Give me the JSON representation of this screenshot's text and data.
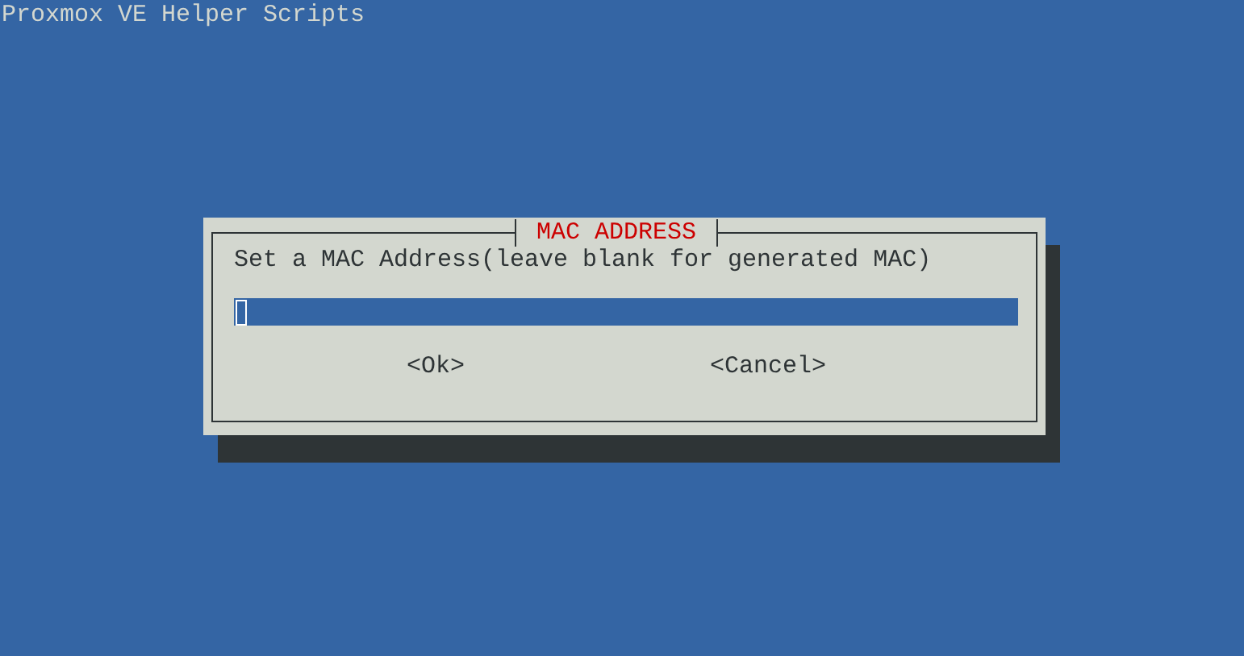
{
  "screen_title": "Proxmox VE Helper Scripts",
  "dialog": {
    "title": "MAC ADDRESS",
    "prompt": "Set a MAC Address(leave blank for generated MAC)",
    "input": {
      "focused": true
    },
    "buttons": [
      {
        "label": "<Ok>"
      },
      {
        "label": "<Cancel>"
      }
    ]
  }
}
